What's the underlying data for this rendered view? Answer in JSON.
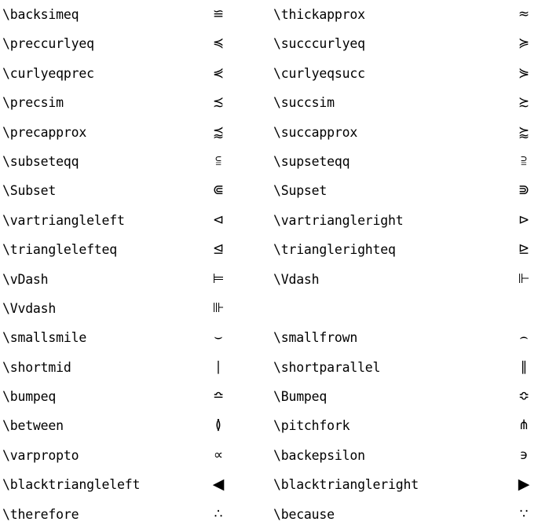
{
  "page": {
    "kind": "latex-symbol-reference-table",
    "background_color": "#ffffff",
    "text_color": "#000000",
    "columns": 2,
    "row_count": 17
  },
  "rows": [
    {
      "left": {
        "command": "\\backsimeq",
        "symbol": "≌"
      },
      "right": {
        "command": "\\thickapprox",
        "symbol": "≈"
      }
    },
    {
      "left": {
        "command": "\\preccurlyeq",
        "symbol": "≼"
      },
      "right": {
        "command": "\\succcurlyeq",
        "symbol": "≽"
      }
    },
    {
      "left": {
        "command": "\\curlyeqprec",
        "symbol": "⋞"
      },
      "right": {
        "command": "\\curlyeqsucc",
        "symbol": "⋟"
      }
    },
    {
      "left": {
        "command": "\\precsim",
        "symbol": "≾"
      },
      "right": {
        "command": "\\succsim",
        "symbol": "≿"
      }
    },
    {
      "left": {
        "command": "\\precapprox",
        "symbol": "⪷"
      },
      "right": {
        "command": "\\succapprox",
        "symbol": "⪸"
      }
    },
    {
      "left": {
        "command": "\\subseteqq",
        "symbol": "⫅"
      },
      "right": {
        "command": "\\supseteqq",
        "symbol": "⫆"
      }
    },
    {
      "left": {
        "command": "\\Subset",
        "symbol": "⋐"
      },
      "right": {
        "command": "\\Supset",
        "symbol": "⋑"
      }
    },
    {
      "left": {
        "command": "\\vartriangleleft",
        "symbol": "⊲"
      },
      "right": {
        "command": "\\vartriangleright",
        "symbol": "⊳"
      }
    },
    {
      "left": {
        "command": "\\trianglelefteq",
        "symbol": "⊴"
      },
      "right": {
        "command": "\\trianglerighteq",
        "symbol": "⊵"
      }
    },
    {
      "left": {
        "command": "\\vDash",
        "symbol": "⊨"
      },
      "right": {
        "command": "\\Vdash",
        "symbol": "⊩"
      }
    },
    {
      "left": {
        "command": "\\Vvdash",
        "symbol": "⊪"
      },
      "right": {
        "command": "",
        "symbol": ""
      }
    },
    {
      "left": {
        "command": "\\smallsmile",
        "symbol": "⌣"
      },
      "right": {
        "command": "\\smallfrown",
        "symbol": "⌢"
      }
    },
    {
      "left": {
        "command": "\\shortmid",
        "symbol": "∣"
      },
      "right": {
        "command": "\\shortparallel",
        "symbol": "∥"
      }
    },
    {
      "left": {
        "command": "\\bumpeq",
        "symbol": "≏"
      },
      "right": {
        "command": "\\Bumpeq",
        "symbol": "≎"
      }
    },
    {
      "left": {
        "command": "\\between",
        "symbol": "≬"
      },
      "right": {
        "command": "\\pitchfork",
        "symbol": "⋔"
      }
    },
    {
      "left": {
        "command": "\\varpropto",
        "symbol": "∝"
      },
      "right": {
        "command": "\\backepsilon",
        "symbol": "϶"
      }
    },
    {
      "left": {
        "command": "\\blacktriangleleft",
        "symbol": "◀"
      },
      "right": {
        "command": "\\blacktriangleright",
        "symbol": "▶"
      }
    },
    {
      "left": {
        "command": "\\therefore",
        "symbol": "∴"
      },
      "right": {
        "command": "\\because",
        "symbol": "∵"
      }
    }
  ]
}
